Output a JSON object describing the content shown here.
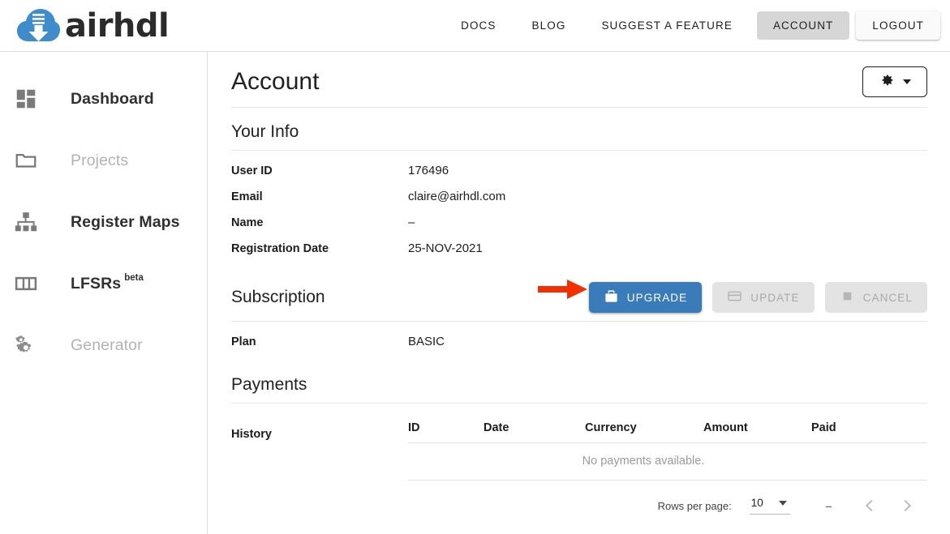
{
  "header": {
    "logo_text": "airhdl",
    "logo_icon": "cloud-download-icon",
    "nav_links": [
      {
        "label": "DOCS",
        "name": "nav-docs"
      },
      {
        "label": "BLOG",
        "name": "nav-blog"
      },
      {
        "label": "SUGGEST A FEATURE",
        "name": "nav-suggest-a-feature"
      }
    ],
    "account_label": "ACCOUNT",
    "logout_label": "LOGOUT"
  },
  "sidebar": {
    "items": [
      {
        "label": "Dashboard",
        "icon": "dashboard-icon",
        "disabled": false
      },
      {
        "label": "Projects",
        "icon": "folder-icon",
        "disabled": true
      },
      {
        "label": "Register Maps",
        "icon": "account-tree-icon",
        "disabled": false
      },
      {
        "label": "LFSRs",
        "badge": "beta",
        "icon": "view-column-icon",
        "disabled": false
      },
      {
        "label": "Generator",
        "icon": "gears-icon",
        "disabled": true
      }
    ]
  },
  "page": {
    "title": "Account",
    "settings_icon": "gear-icon",
    "settings_caret": "chevron-down-icon"
  },
  "your_info": {
    "heading": "Your Info",
    "rows": [
      {
        "label": "User ID",
        "value": "176496"
      },
      {
        "label": "Email",
        "value": "claire@airhdl.com"
      },
      {
        "label": "Name",
        "value": "–"
      },
      {
        "label": "Registration Date",
        "value": "25-NOV-2021"
      }
    ]
  },
  "subscription": {
    "heading": "Subscription",
    "annotation": "red-arrow-pointing-to-upgrade",
    "buttons": [
      {
        "label": "UPGRADE",
        "icon": "briefcase-icon",
        "state": "enabled",
        "color": "#3a7cb9"
      },
      {
        "label": "UPDATE",
        "icon": "credit-card-icon",
        "state": "disabled"
      },
      {
        "label": "CANCEL",
        "icon": "stop-square-icon",
        "state": "disabled"
      }
    ],
    "plan_label": "Plan",
    "plan_value": "BASIC"
  },
  "payments": {
    "heading": "Payments",
    "history_label": "History",
    "columns": [
      "ID",
      "Date",
      "Currency",
      "Amount",
      "Paid"
    ],
    "rows": [],
    "empty_message": "No payments available.",
    "paginator": {
      "rows_per_page_label": "Rows per page:",
      "rows_per_page_value": "10",
      "range_label": "–",
      "prev_icon": "chevron-left-icon",
      "next_icon": "chevron-right-icon"
    }
  },
  "colors": {
    "brand_blue": "#3a7cb9",
    "annotation_red": "#f03000",
    "disabled_gray": "#e3e3e3",
    "border": "#dcdcdc"
  }
}
